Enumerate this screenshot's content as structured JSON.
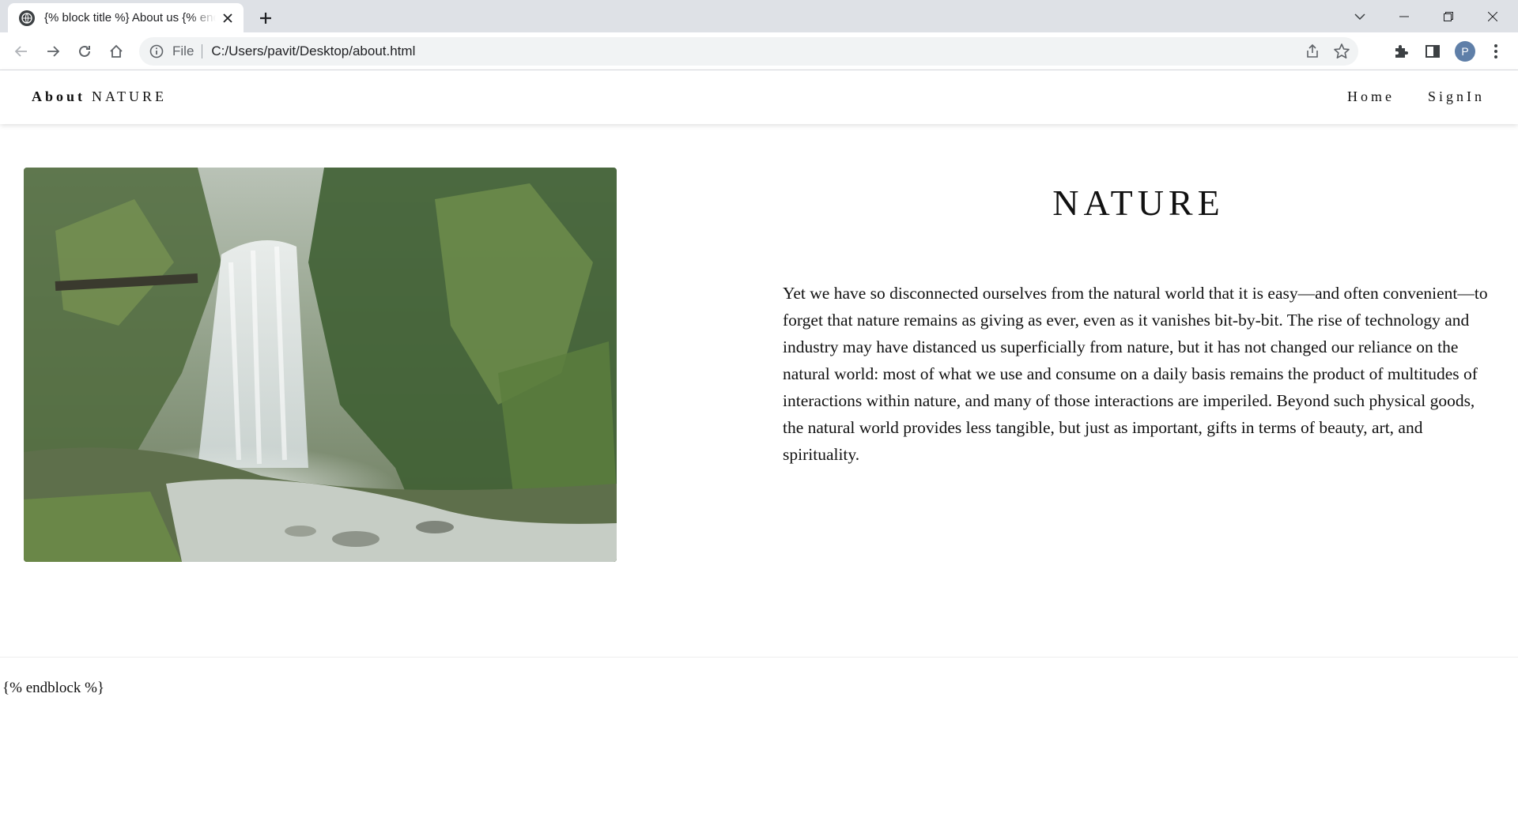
{
  "browser": {
    "tab_title": "{% block title %} About us {% endblock %}",
    "url_scheme": "File",
    "url": "C:/Users/pavit/Desktop/about.html",
    "profile_initial": "P"
  },
  "site": {
    "brand_bold": "About",
    "brand_rest": "NATURE",
    "nav": [
      {
        "label": "Home"
      },
      {
        "label": "SignIn"
      }
    ],
    "heading": "NATURE",
    "paragraph": "Yet we have so disconnected ourselves from the natural world that it is easy—and often convenient—to forget that nature remains as giving as ever, even as it vanishes bit-by-bit. The rise of technology and industry may have distanced us superficially from nature, but it has not changed our reliance on the natural world: most of what we use and consume on a daily basis remains the product of multitudes of interactions within nature, and many of those interactions are imperiled. Beyond such physical goods, the natural world provides less tangible, but just as important, gifts in terms of beauty, art, and spirituality.",
    "footer_text": "{% endblock %}"
  },
  "colors": {
    "tabstrip": "#dee1e6",
    "omnibox": "#f1f3f4",
    "text": "#111111"
  }
}
